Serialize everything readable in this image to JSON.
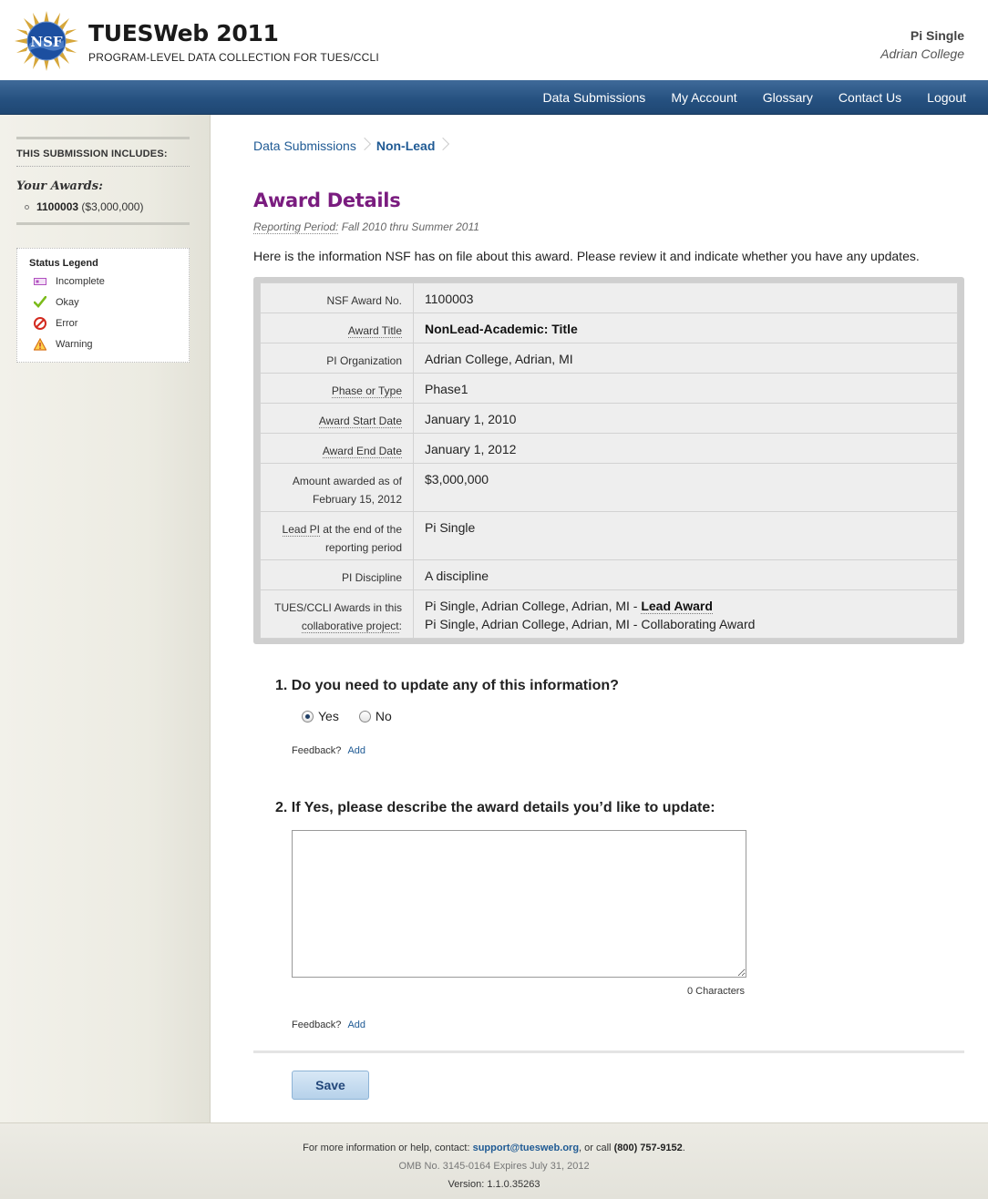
{
  "header": {
    "title": "TUESWeb 2011",
    "subtitle": "PROGRAM-LEVEL DATA COLLECTION FOR TUES/CCLI",
    "logo_text": "NSF",
    "user_name": "Pi Single",
    "user_org": "Adrian College"
  },
  "nav": {
    "items": [
      "Data Submissions",
      "My Account",
      "Glossary",
      "Contact Us",
      "Logout"
    ]
  },
  "sidebar": {
    "heading": "THIS SUBMISSION INCLUDES:",
    "awards_title": "Your Awards:",
    "award_id": "1100003",
    "award_amount": "($3,000,000)",
    "legend_title": "Status Legend",
    "legend": [
      "Incomplete",
      "Okay",
      "Error",
      "Warning"
    ]
  },
  "breadcrumb": {
    "items": [
      "Data Submissions",
      "Non-Lead"
    ]
  },
  "page": {
    "title": "Award Details",
    "period_label": "Reporting Period:",
    "period_value": " Fall 2010 thru Summer 2011",
    "intro": "Here is the information NSF has on file about this award. Please review it and indicate whether you have any updates."
  },
  "details": {
    "award_no_label": "NSF Award No.",
    "award_no": "1100003",
    "title_label": "Award Title",
    "title_value": "NonLead-Academic: Title",
    "org_label": "PI Organization",
    "org_value": "Adrian College, Adrian, MI",
    "phase_label": "Phase or Type",
    "phase_value": "Phase1",
    "start_label": "Award Start Date",
    "start_value": "January 1, 2010",
    "end_label": "Award End Date",
    "end_value": "January 1, 2012",
    "amount_label_1": "Amount awarded as of",
    "amount_label_2": "February 15, 2012",
    "amount_value": "$3,000,000",
    "lead_label_link": "Lead PI",
    "lead_label_rest": " at the end of the",
    "lead_label_2": "reporting period",
    "lead_value": "Pi Single",
    "discipline_label": "PI Discipline",
    "discipline_value": "A discipline",
    "collab_label_1": "TUES/CCLI Awards in this",
    "collab_label_2": "collaborative project",
    "collab_label_colon": ":",
    "collab_line1_prefix": "Pi Single, Adrian College, Adrian, MI - ",
    "collab_line1_bold": "Lead Award",
    "collab_line2": "Pi Single, Adrian College, Adrian, MI - Collaborating Award"
  },
  "form": {
    "q1": "1. Do you need to update any of this information?",
    "yes": "Yes",
    "no": "No",
    "selected": "Yes",
    "feedback_label": "Feedback?",
    "feedback_link": "Add",
    "q2": "2. If Yes, please describe the award details you’d like to update:",
    "textarea_value": "",
    "char_count": "0 Characters",
    "save": "Save"
  },
  "footer": {
    "help_prefix": "For more information or help, contact: ",
    "email": "support@tuesweb.org",
    "help_mid": ", or call ",
    "phone": "(800) 757-9152",
    "help_end": ".",
    "omb": "OMB No. 3145-0164 Expires July 31, 2012",
    "version": "Version: 1.1.0.35263"
  },
  "colors": {
    "nav": "#25507f",
    "title": "#7a1c7f",
    "link": "#1f5a94"
  }
}
